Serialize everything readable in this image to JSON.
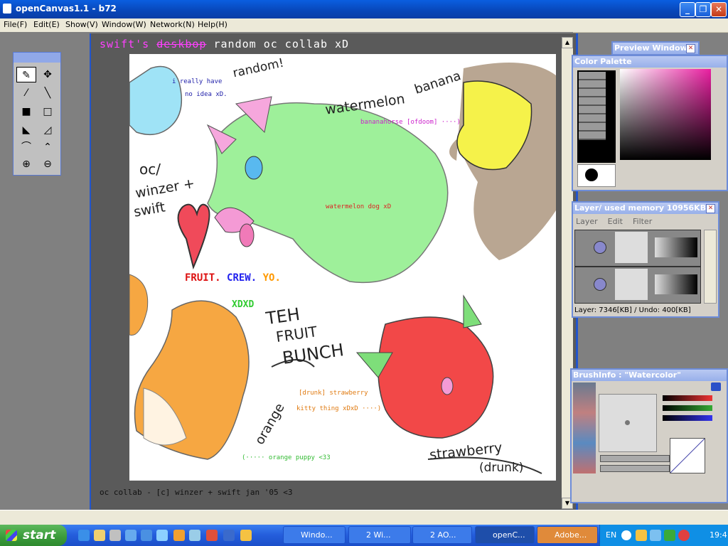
{
  "window": {
    "title": "openCanvas1.1 - b72"
  },
  "menu": [
    "File(F)",
    "Edit(E)",
    "Show(V)",
    "Window(W)",
    "Network(N)",
    "Help(H)"
  ],
  "canvas": {
    "title_swift": "swift's",
    "title_strike": "deskbop",
    "title_rest": "random oc collab xD",
    "footer": "oc collab - [c] winzer + swift jan '05 <3",
    "texts": {
      "really": "i really have",
      "noidea": "no idea xD.",
      "random": "random!",
      "banana": "banana",
      "watermelon": "watermelon",
      "bananahorse": "bananahorse [ofdoom] ····)",
      "oc1": "oc/",
      "oc2": "winzer +",
      "oc3": "swift",
      "wmdog": "watermelon dog xD",
      "fruit": "FRUIT.",
      "crew": "CREW.",
      "yo": "YO.",
      "xdxd": "XDXD",
      "teh": "TEH",
      "fruit2": "FRUIT",
      "bunch": "BUNCH",
      "orange": "orange",
      "drunk": "[drunk] strawberry",
      "kitty": "kitty thing xDxD ····)",
      "puppy": "(····· orange puppy <33",
      "strawberry": "strawberry",
      "drunk2": "(drunk)"
    }
  },
  "panels": {
    "preview": {
      "title": "Preview Window"
    },
    "color": {
      "title": "Color Palette"
    },
    "layer": {
      "title": "Layer/ used memory 10956KB",
      "tabs": [
        "Layer",
        "Edit",
        "Filter"
      ],
      "status": "Layer: 7346[KB] / Undo: 400[KB]"
    },
    "brush": {
      "title": "BrushInfo : \"Watercolor\""
    }
  },
  "taskbar": {
    "start": "start",
    "tasks": [
      "Windo...",
      "2 Wi...",
      "2 AO...",
      "openC...",
      "Adobe..."
    ],
    "lang": "EN",
    "clock": "19:4"
  },
  "colors": {
    "accent": "#0a5fe0",
    "taskbar": "#245ddb",
    "start": "#3a9a3a"
  }
}
